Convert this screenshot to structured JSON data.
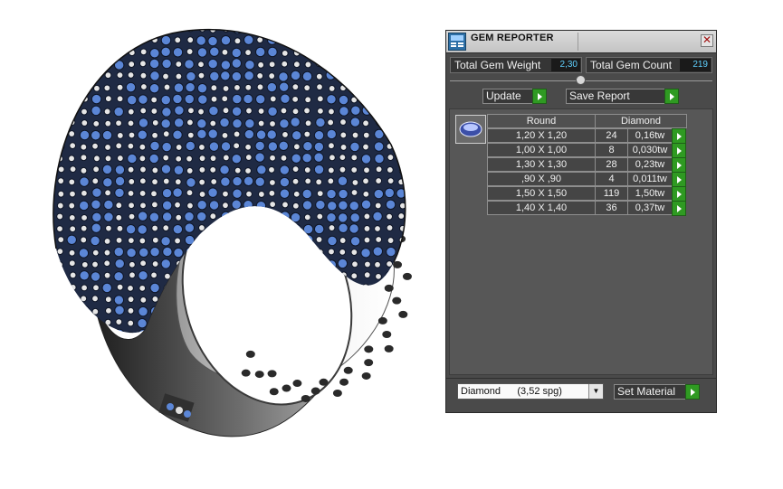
{
  "panel": {
    "title": "GEM REPORTER",
    "close_glyph": "✕",
    "total_weight_label": "Total Gem Weight",
    "total_weight_value": "2,30",
    "total_count_label": "Total Gem Count",
    "total_count_value": "219",
    "update_label": "Update",
    "save_report_label": "Save Report",
    "table": {
      "headers": [
        "Round",
        "Diamond"
      ],
      "rows": [
        {
          "size": "1,20 X 1,20",
          "count": "24",
          "weight": "0,16tw"
        },
        {
          "size": "1,00 X 1,00",
          "count": "8",
          "weight": "0,030tw"
        },
        {
          "size": "1,30 X 1,30",
          "count": "28",
          "weight": "0,23tw"
        },
        {
          "size": ",90 X ,90",
          "count": "4",
          "weight": "0,011tw"
        },
        {
          "size": "1,50 X 1,50",
          "count": "119",
          "weight": "1,50tw"
        },
        {
          "size": "1,40 X 1,40",
          "count": "36",
          "weight": "0,37tw"
        }
      ]
    },
    "material_select": "Diamond      (3,52 spg)",
    "set_material_label": "Set Material"
  },
  "icons": {
    "app": "gem-reporter-icon",
    "close": "close-icon",
    "go": "play-arrow-icon",
    "thumb": "round-gem-icon",
    "dropdown": "chevron-down-icon"
  },
  "colors": {
    "panel_bg": "#4a4a4a",
    "accent_green": "#2f9a22",
    "value_text": "#5fd0ff",
    "stone_blue": "#5b86d6"
  }
}
